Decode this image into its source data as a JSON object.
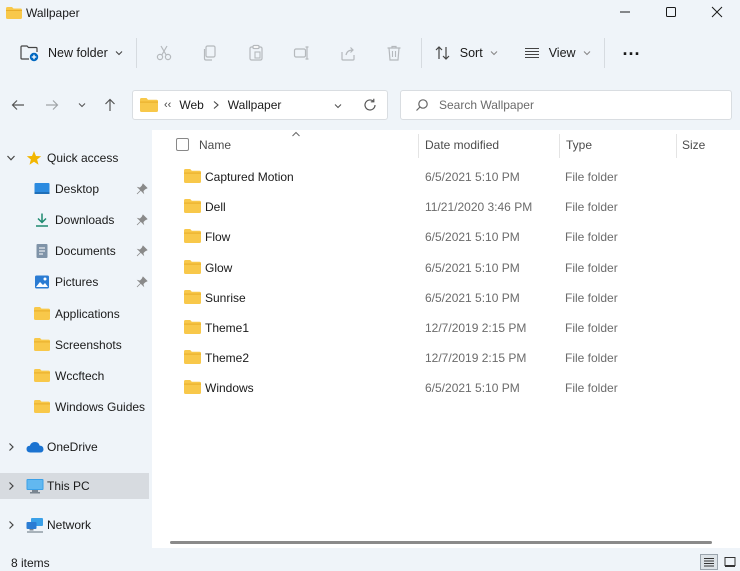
{
  "window": {
    "title": "Wallpaper"
  },
  "toolbar": {
    "new_folder": "New folder",
    "sort": "Sort",
    "view": "View",
    "more": "..."
  },
  "address": {
    "prev": "‹‹",
    "path": [
      "Web",
      "Wallpaper"
    ]
  },
  "search": {
    "placeholder": "Search Wallpaper"
  },
  "columns": {
    "name": "Name",
    "date": "Date modified",
    "type": "Type",
    "size": "Size"
  },
  "files": [
    {
      "name": "Captured Motion",
      "date": "6/5/2021 5:10 PM",
      "type": "File folder"
    },
    {
      "name": "Dell",
      "date": "11/21/2020 3:46 PM",
      "type": "File folder"
    },
    {
      "name": "Flow",
      "date": "6/5/2021 5:10 PM",
      "type": "File folder"
    },
    {
      "name": "Glow",
      "date": "6/5/2021 5:10 PM",
      "type": "File folder"
    },
    {
      "name": "Sunrise",
      "date": "6/5/2021 5:10 PM",
      "type": "File folder"
    },
    {
      "name": "Theme1",
      "date": "12/7/2019 2:15 PM",
      "type": "File folder"
    },
    {
      "name": "Theme2",
      "date": "12/7/2019 2:15 PM",
      "type": "File folder"
    },
    {
      "name": "Windows",
      "date": "6/5/2021 5:10 PM",
      "type": "File folder"
    }
  ],
  "nav": {
    "quick_access": "Quick access",
    "quick_items": [
      {
        "label": "Desktop",
        "icon": "desktop-icon",
        "pinned": true
      },
      {
        "label": "Downloads",
        "icon": "download-icon",
        "pinned": true
      },
      {
        "label": "Documents",
        "icon": "document-icon",
        "pinned": true
      },
      {
        "label": "Pictures",
        "icon": "picture-icon",
        "pinned": true
      },
      {
        "label": "Applications",
        "icon": "folder-icon",
        "pinned": false
      },
      {
        "label": "Screenshots",
        "icon": "folder-icon",
        "pinned": false
      },
      {
        "label": "Wccftech",
        "icon": "folder-icon",
        "pinned": false
      },
      {
        "label": "Windows Guides",
        "icon": "folder-icon",
        "pinned": false
      }
    ],
    "onedrive": "OneDrive",
    "this_pc": "This PC",
    "network": "Network"
  },
  "status": {
    "count": "8 items"
  },
  "colors": {
    "folder": "#f8c84a",
    "folder_dark": "#e8ad2a",
    "star": "#f2b600",
    "cloud": "#1b73d1",
    "accent": "#0067c0"
  }
}
